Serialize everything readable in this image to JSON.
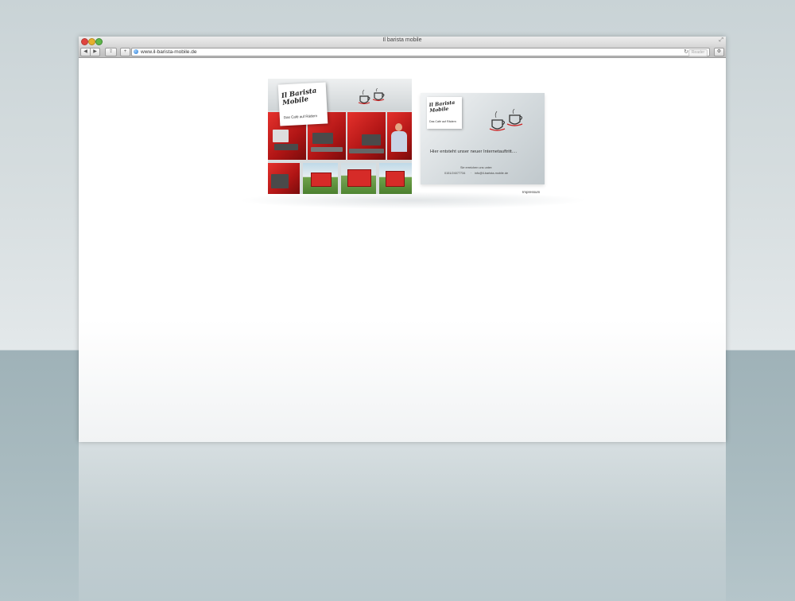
{
  "window": {
    "title": "Il barista mobile",
    "url": "www.il-barista-mobile.de",
    "reader_label": "Reader"
  },
  "icons": {
    "back": "triangle-left",
    "forward": "triangle-right",
    "share": "share-icon",
    "add": "plus-icon",
    "globe": "globe-icon",
    "reload": "reload-icon",
    "settings": "gear-icon",
    "resize": "fullscreen-icon"
  },
  "glyphs": {
    "back": "◀",
    "forward": "▶",
    "share": "⇪",
    "add": "+",
    "reload": "↻",
    "settings": "⚙",
    "resize": "⤢"
  },
  "page": {
    "logo": {
      "title": "Il Barista Mobile",
      "tagline": "Das Café auf Rädern"
    },
    "card": {
      "headline": "Hier entsteht unser neuer Internetauftritt....",
      "contact_label": "Sie erreichen uns unter:",
      "phone": "0151/24077734",
      "separator": "·",
      "email": "info@il-barista-mobile.de"
    },
    "impressum_label": "Impressum"
  },
  "colors": {
    "brand_red": "#d62b28",
    "card_gray": "#c9d0d4"
  }
}
